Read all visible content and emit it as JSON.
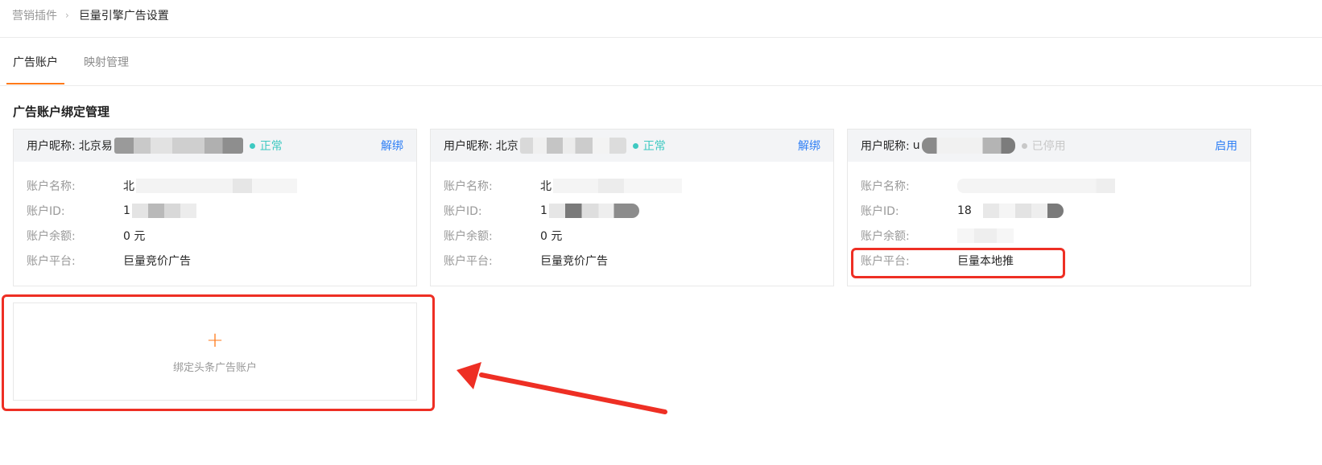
{
  "breadcrumb": {
    "parent": "营销插件",
    "current": "巨量引擎广告设置"
  },
  "tabs": [
    {
      "label": "广告账户"
    },
    {
      "label": "映射管理"
    }
  ],
  "section_title": "广告账户绑定管理",
  "labels": {
    "nickname": "用户昵称:",
    "account_name": "账户名称:",
    "account_id": "账户ID:",
    "balance": "账户余额:",
    "platform": "账户平台:"
  },
  "cards": [
    {
      "nickname": "北京易",
      "status": "正常",
      "status_color": "#3ec9c1",
      "action": "解绑",
      "account_name": "北",
      "account_id": "1",
      "balance": "0 元",
      "platform": "巨量竞价广告"
    },
    {
      "nickname": "北京",
      "status": "正常",
      "status_color": "#3ec9c1",
      "action": "解绑",
      "account_name": "北",
      "account_id": "1",
      "balance": "0 元",
      "platform": "巨量竞价广告"
    },
    {
      "nickname": "u",
      "status": "已停用",
      "status_color": "#c8c8c8",
      "action": "启用",
      "account_name": "",
      "account_id": "18",
      "balance": "",
      "platform": "巨量本地推"
    }
  ],
  "add_card": {
    "icon": "plus-icon",
    "label": "绑定头条广告账户"
  },
  "colors": {
    "accent": "#ff7a1a",
    "link": "#2f7ff5",
    "annotation": "#ee2f24"
  }
}
